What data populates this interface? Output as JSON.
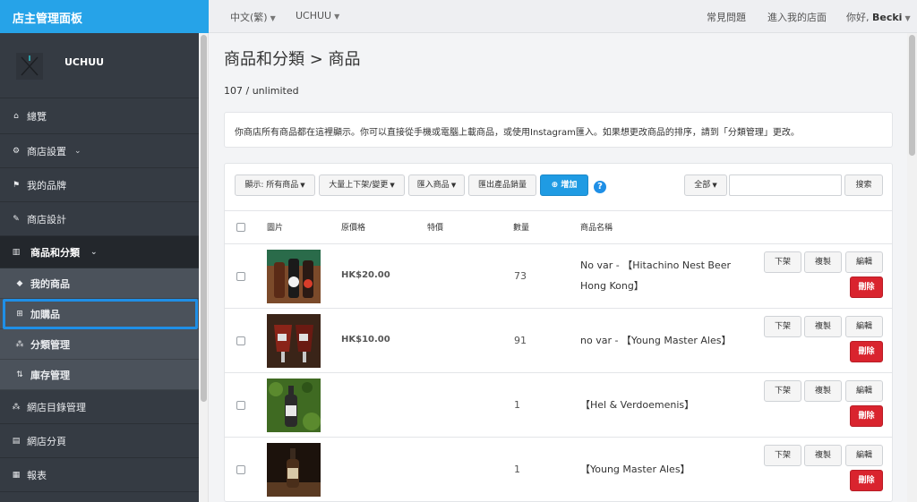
{
  "brand": {
    "title": "店主管理面板"
  },
  "topbar": {
    "language": "中文(繁)",
    "store": "UCHUU",
    "faq": "常見問題",
    "enter_store": "進入我的店面",
    "greeting": "你好,",
    "user": "Becki"
  },
  "sidebar": {
    "shop_name": "UCHUU",
    "items": [
      {
        "label": "總覽",
        "icon": "home-icon"
      },
      {
        "label": "商店設置",
        "icon": "gear-icon"
      },
      {
        "label": "我的品牌",
        "icon": "flag-icon"
      },
      {
        "label": "商店設計",
        "icon": "wand-icon"
      },
      {
        "label": "商品和分類",
        "icon": "barcode-icon"
      },
      {
        "label": "我的商品",
        "icon": "tag-icon"
      },
      {
        "label": "加購品",
        "icon": "plus-square-icon"
      },
      {
        "label": "分類管理",
        "icon": "sitemap-icon"
      },
      {
        "label": "庫存管理",
        "icon": "sort-icon"
      },
      {
        "label": "網店目錄管理",
        "icon": "sitemap-icon"
      },
      {
        "label": "網店分頁",
        "icon": "file-icon"
      },
      {
        "label": "報表",
        "icon": "chart-icon"
      }
    ]
  },
  "page": {
    "title": "商品和分類 > 商品",
    "quota": "107 / unlimited",
    "notice": "你商店所有商品都在這裡顯示。你可以直接從手機或電腦上載商品，或使用Instagram匯入。如果想更改商品的排序，請到「分類管理」更改。"
  },
  "toolbar": {
    "show_all": "顯示: 所有商品",
    "bulk": "大量上下架/變更",
    "import": "匯入商品",
    "export": "匯出產品銷量",
    "add": "增加",
    "filter": "全部",
    "search": "搜索",
    "search_value": ""
  },
  "table": {
    "headers": {
      "image": "圖片",
      "price": "原價格",
      "sale": "特價",
      "qty": "數量",
      "name": "商品名稱"
    },
    "actions": {
      "unlist": "下架",
      "copy": "複製",
      "edit": "編輯",
      "delete": "刪除"
    },
    "rows": [
      {
        "price": "HK$20.00",
        "sale": "",
        "qty": "73",
        "name": "No var - 【Hitachino Nest Beer Hong Kong】"
      },
      {
        "price": "HK$10.00",
        "sale": "",
        "qty": "91",
        "name": "no var - 【Young Master Ales】"
      },
      {
        "price": "",
        "sale": "",
        "qty": "1",
        "name": "【Hel & Verdoemenis】"
      },
      {
        "price": "",
        "sale": "",
        "qty": "1",
        "name": "【Young Master Ales】"
      }
    ]
  }
}
